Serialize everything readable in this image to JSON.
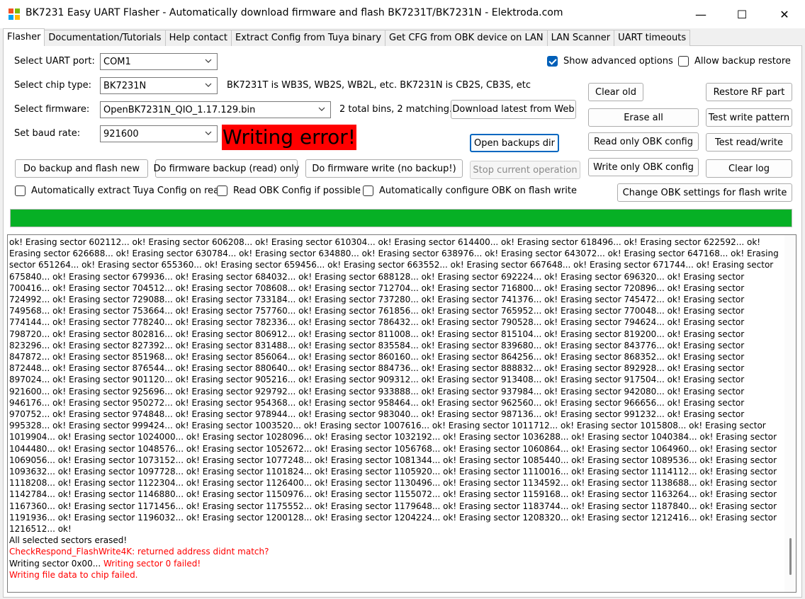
{
  "window": {
    "title": "BK7231 Easy UART Flasher - Automatically download firmware and flash BK7231T/BK7231N  - Elektroda.com",
    "minimize": "—",
    "maximize": "☐",
    "close": "✕"
  },
  "tabs": [
    {
      "label": "Flasher",
      "active": true
    },
    {
      "label": "Documentation/Tutorials"
    },
    {
      "label": "Help contact"
    },
    {
      "label": "Extract Config from Tuya binary"
    },
    {
      "label": "Get CFG from OBK device on LAN"
    },
    {
      "label": "LAN Scanner"
    },
    {
      "label": "UART timeouts"
    }
  ],
  "form": {
    "uart_label": "Select UART port:",
    "uart_value": "COM1",
    "chip_label": "Select chip type:",
    "chip_value": "BK7231N",
    "chip_info": "BK7231T is WB3S, WB2S, WB2L, etc. BK7231N is CB2S, CB3S, etc",
    "firmware_label": "Select firmware:",
    "firmware_value": "OpenBK7231N_QIO_1.17.129.bin",
    "firmware_info": "2 total bins, 2 matching.",
    "baud_label": "Set baud rate:",
    "baud_value": "921600",
    "error_text": "Writing error!"
  },
  "options": {
    "show_advanced": {
      "label": "Show advanced options",
      "checked": true
    },
    "allow_backup_restore": {
      "label": "Allow backup restore",
      "checked": false
    },
    "auto_extract_tuya": {
      "label": "Automatically extract Tuya Config on read",
      "checked": false
    },
    "read_obk_config": {
      "label": "Read OBK Config if possible",
      "checked": false
    },
    "auto_configure_obk": {
      "label": "Automatically configure OBK on flash write",
      "checked": false
    }
  },
  "buttons": {
    "download_latest": "Download latest from Web",
    "open_backups": "Open backups dir",
    "backup_flash_new": "Do backup and flash new",
    "firmware_backup": "Do firmware backup (read) only",
    "firmware_write": "Do firmware write (no backup!)",
    "stop_operation": "Stop current operation",
    "clear_old": "Clear old",
    "erase_all": "Erase all",
    "read_obk_config": "Read only OBK config",
    "write_obk_config": "Write only OBK config",
    "restore_rf": "Restore RF part",
    "test_write_pattern": "Test write pattern",
    "test_read_write": "Test read/write",
    "clear_log": "Clear log",
    "change_obk_settings": "Change OBK settings for flash write"
  },
  "progress": {
    "value": 1.0,
    "color": "#06b025"
  },
  "colors": {
    "error_bg": "#ff0000",
    "error_text": "#ff0000",
    "accent": "#005fb8"
  },
  "log": {
    "erase_start": 602112,
    "erase_end": 1216512,
    "erase_step": 4096,
    "lines_pre": "ok! ",
    "all_erased": "All selected sectors erased!",
    "check_respond_error": "CheckRespond_FlashWrite4K: returned address didnt match?",
    "writing_sector": "Writing sector 0x00...",
    "writing_sector_failed": " Writing sector 0 failed!",
    "writing_file_failed": "Writing file data to chip failed."
  }
}
